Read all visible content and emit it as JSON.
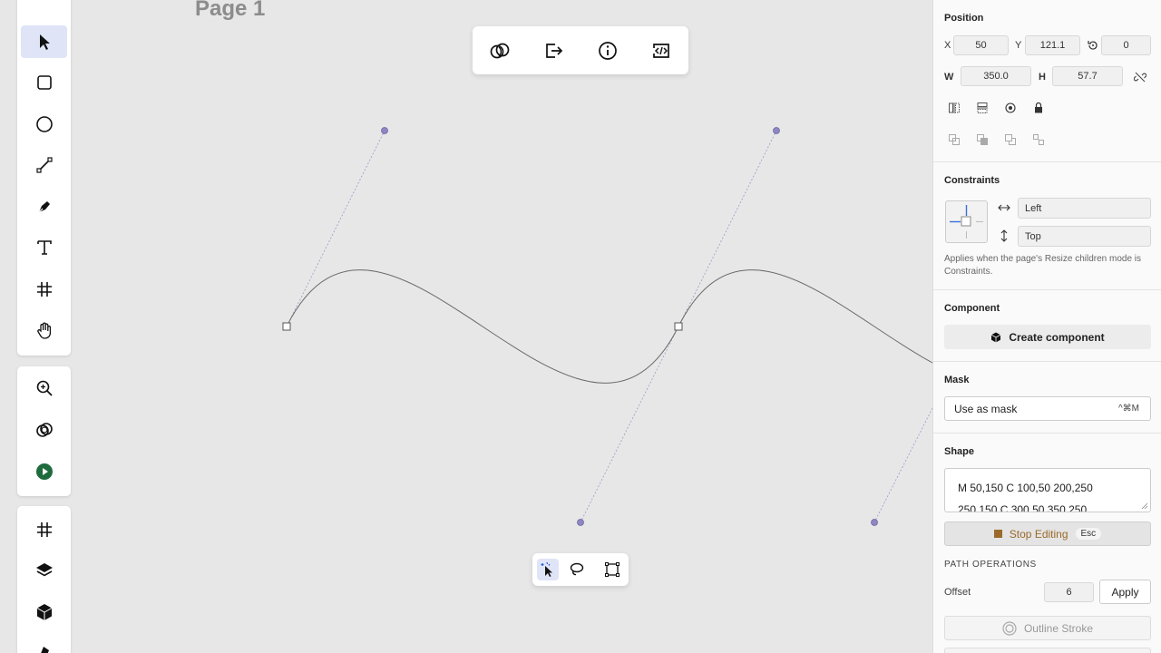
{
  "canvas": {
    "page_title": "Page 1",
    "curve_color": "#666666",
    "handle_color": "#8e86c0"
  },
  "left_toolbar": {
    "main_tools": [
      "app-logo-icon",
      "select-icon",
      "rectangle-icon",
      "ellipse-icon",
      "line-icon",
      "pen-icon",
      "text-icon",
      "frame-icon",
      "hand-icon"
    ],
    "mid_tools": [
      "zoom-icon",
      "boolean-icon",
      "play-icon"
    ],
    "bottom_tools": [
      "frame-icon",
      "layers-icon",
      "components-icon",
      "theme-icon"
    ]
  },
  "top_toolbar": {
    "buttons": [
      "boolean-icon",
      "export-icon",
      "info-icon",
      "code-icon"
    ]
  },
  "bottom_toolbar": {
    "buttons": [
      "direct-select-icon",
      "lasso-icon",
      "transform-icon"
    ]
  },
  "panel": {
    "position": {
      "title": "Position",
      "x_label": "X",
      "x_value": "50",
      "y_label": "Y",
      "y_value": "121.1",
      "rotation_value": "0",
      "w_label": "W",
      "w_value": "350.0",
      "h_label": "H",
      "h_value": "57.7"
    },
    "constraints": {
      "title": "Constraints",
      "horizontal": "Left",
      "vertical": "Top",
      "help": "Applies when the page's Resize children mode is Constraints."
    },
    "component": {
      "title": "Component",
      "create_label": "Create component"
    },
    "mask": {
      "title": "Mask",
      "use_label": "Use as mask",
      "shortcut": "^⌘M"
    },
    "shape": {
      "title": "Shape",
      "path_line1": "M 50,150 C 100,50 200,250",
      "path_line2": "250,150 C 300,50 350,250",
      "stop_label": "Stop Editing",
      "stop_shortcut": "Esc",
      "stop_color": "#9a6a2a",
      "path_ops_title": "PATH OPERATIONS",
      "offset_label": "Offset",
      "offset_value": "6",
      "apply_label": "Apply",
      "outline_label": "Outline Stroke"
    }
  }
}
